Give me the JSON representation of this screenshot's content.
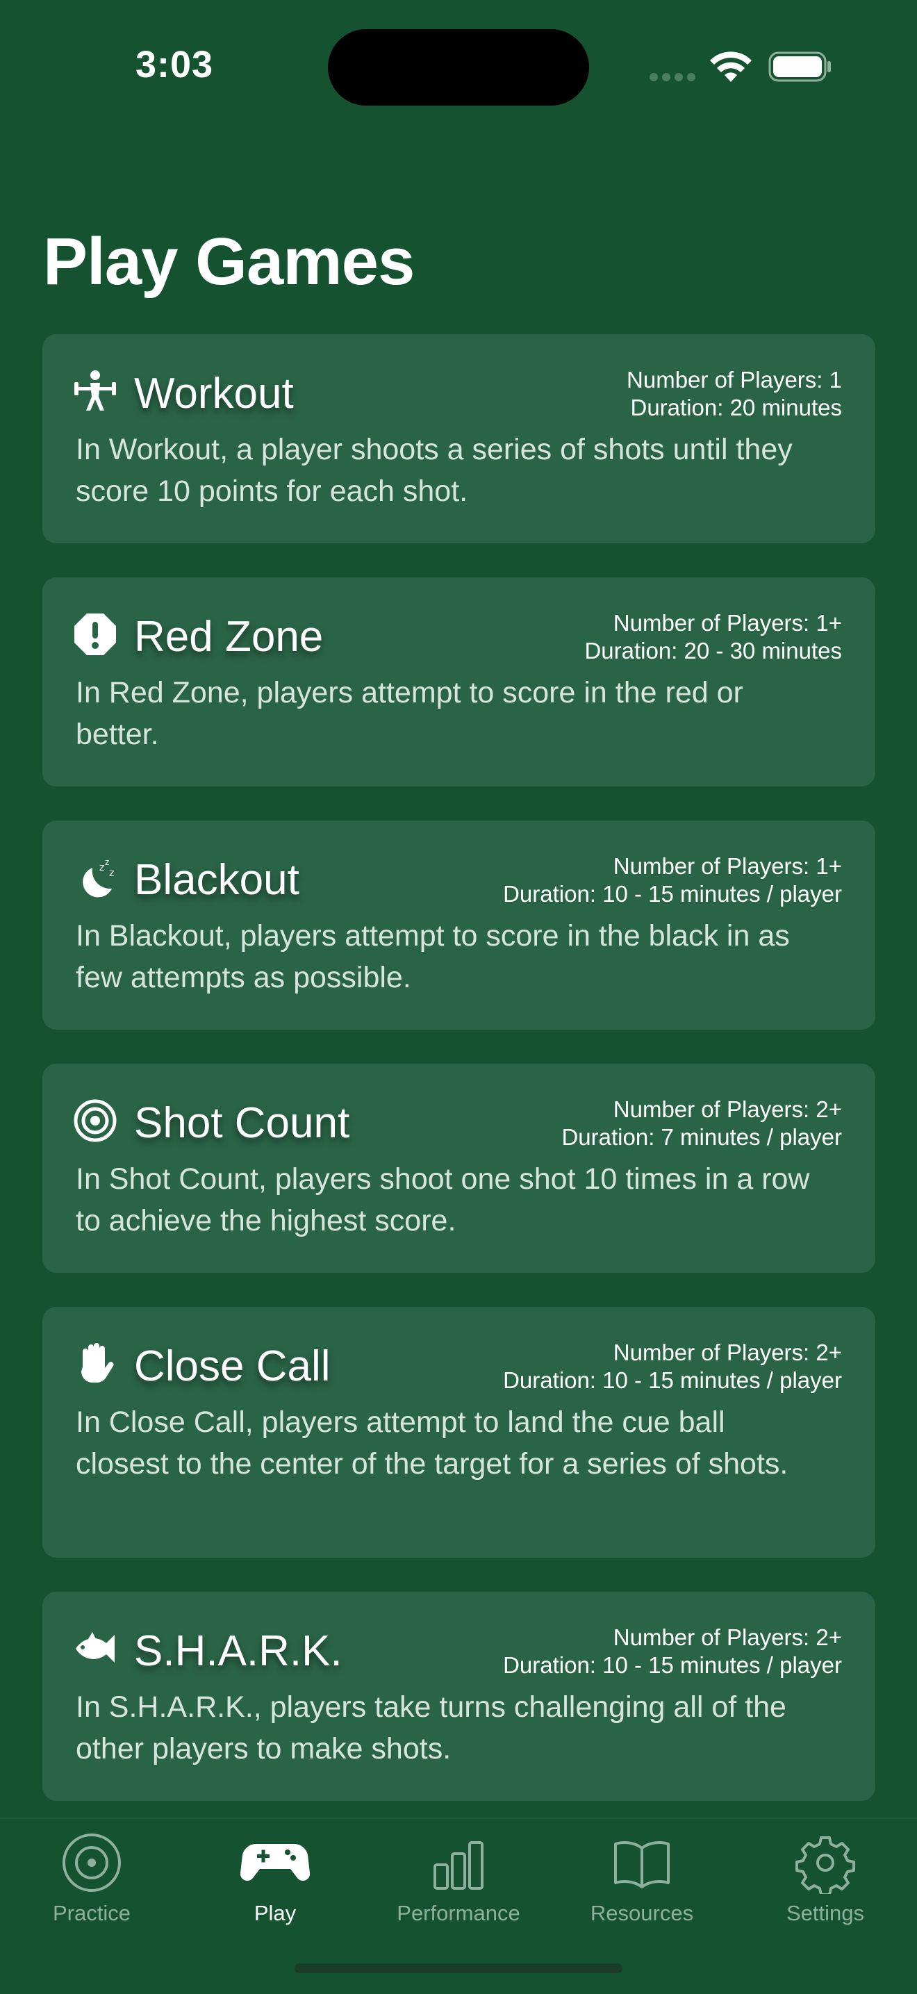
{
  "status_bar": {
    "time": "3:03"
  },
  "page": {
    "title": "Play Games"
  },
  "games": [
    {
      "title": "Workout",
      "icon": "weightlifter-icon",
      "players": "Number of Players: 1",
      "duration": "Duration: 20 minutes",
      "description": "In Workout, a player shoots a series of shots until they score 10 points for each shot."
    },
    {
      "title": "Red Zone",
      "icon": "exclamation-octagon-icon",
      "players": "Number of Players: 1+",
      "duration": "Duration: 20 - 30 minutes",
      "description": "In Red Zone, players attempt to score in the red or better."
    },
    {
      "title": "Blackout",
      "icon": "moon-zzz-icon",
      "players": "Number of Players: 1+",
      "duration": "Duration: 10 - 15 minutes / player",
      "description": "In Blackout, players attempt to score in the black in as few attempts as possible."
    },
    {
      "title": "Shot Count",
      "icon": "target-icon",
      "players": "Number of Players: 2+",
      "duration": "Duration: 7 minutes / player",
      "description": "In Shot Count, players shoot one shot 10 times in a row to achieve the highest score."
    },
    {
      "title": "Close Call",
      "icon": "hand-icon",
      "players": "Number of Players: 2+",
      "duration": "Duration: 10 - 15 minutes / player",
      "description": "In Close Call, players attempt to land the cue ball closest to the center of the target for a series of shots."
    },
    {
      "title": "S.H.A.R.K.",
      "icon": "fish-icon",
      "players": "Number of Players: 2+",
      "duration": "Duration: 10 - 15 minutes / player",
      "description": "In S.H.A.R.K., players take turns challenging all of the other players to make shots."
    }
  ],
  "tab_bar": {
    "tabs": [
      {
        "label": "Practice",
        "icon": "target-circle-icon",
        "active": false
      },
      {
        "label": "Play",
        "icon": "gamecontroller-icon",
        "active": true
      },
      {
        "label": "Performance",
        "icon": "bar-chart-icon",
        "active": false
      },
      {
        "label": "Resources",
        "icon": "book-icon",
        "active": false
      },
      {
        "label": "Settings",
        "icon": "gear-icon",
        "active": false
      }
    ]
  },
  "colors": {
    "background": "#155230",
    "card": "#2a6447",
    "tab_inactive": "#8fb09c"
  }
}
